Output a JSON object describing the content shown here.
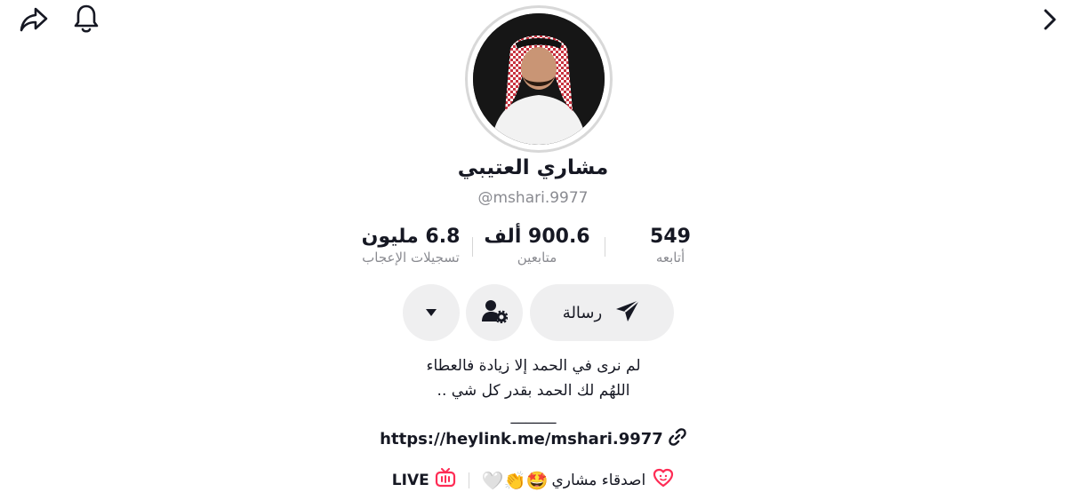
{
  "profile": {
    "display_name": "مشاري العتيبي",
    "handle": "@mshari.9977"
  },
  "stats": {
    "following": {
      "value": "549",
      "label": "أتابعه"
    },
    "followers": {
      "value": "900.6 ألف",
      "label": "متابعين"
    },
    "likes": {
      "value": "6.8 مليون",
      "label": "تسجيلات الإعجاب"
    }
  },
  "actions": {
    "message_label": "رسالة"
  },
  "bio": {
    "line1": "لم نرى في الحمد إلا زيادة فالعطاء",
    "line2": "اللهُم لك الحمد بقدر كل شي ..",
    "line3": "______",
    "link": "https://heylink.me/mshari.9977"
  },
  "bottom": {
    "friends_label": "اصدقاء مشاري",
    "friends_emojis": "🤩👏🤍",
    "live_label": "LIVE"
  },
  "icons": {
    "share": "share-icon",
    "bell": "bell-icon",
    "chevron": "chevron-right-icon",
    "send": "send-icon",
    "person_gear": "person-settings-icon",
    "caret": "caret-down-icon",
    "link": "link-icon",
    "live": "tv-icon",
    "heart_face": "heart-smile-icon"
  },
  "colors": {
    "accent": "#fe2c55",
    "muted": "#8a8b91",
    "pill_bg": "#efeff0"
  }
}
